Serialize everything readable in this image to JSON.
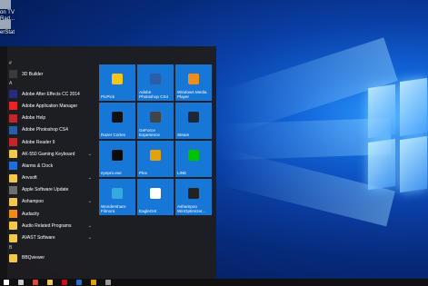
{
  "desktop": {
    "icons": [
      {
        "label": "on TV"
      },
      {
        "label": "Rad..."
      },
      {
        "label": "erStat"
      }
    ]
  },
  "start_menu": {
    "pinned_top": {
      "label": "3D Builder"
    },
    "sections": [
      {
        "letter": "#",
        "items": [
          {
            "label": "3D Builder"
          }
        ]
      },
      {
        "letter": "A",
        "items": [
          {
            "label": "Adobe After Effects CC 2014",
            "icon": "after-effects-icon",
            "color": "#2a2a7a"
          },
          {
            "label": "Adobe Application Manager",
            "icon": "adobe-icon",
            "color": "#e8242a"
          },
          {
            "label": "Adobe Help",
            "icon": "adobe-help-icon",
            "color": "#c0272d"
          },
          {
            "label": "Adobe Photoshop CS4",
            "icon": "photoshop-icon",
            "color": "#2a5fa8"
          },
          {
            "label": "Adobe Reader 9",
            "icon": "acrobat-icon",
            "color": "#c0272d"
          },
          {
            "label": "AK-550 Gaming Keyboard",
            "icon": "folder-icon",
            "expandable": true
          },
          {
            "label": "Alarms & Clock",
            "icon": "alarm-clock-icon",
            "color": "#1f6fd6"
          },
          {
            "label": "Anvsoft",
            "icon": "folder-icon",
            "expandable": true
          },
          {
            "label": "Apple Software Update",
            "icon": "apple-update-icon",
            "color": "#6e6e6e"
          },
          {
            "label": "Ashampoo",
            "icon": "folder-icon",
            "expandable": true
          },
          {
            "label": "Audacity",
            "icon": "audacity-icon",
            "color": "#f08c1c"
          },
          {
            "label": "Audio Related Programs",
            "icon": "folder-icon",
            "expandable": true
          },
          {
            "label": "AVAST Software",
            "icon": "folder-icon",
            "expandable": true
          }
        ]
      },
      {
        "letter": "B",
        "items": [
          {
            "label": "BBQviewer",
            "icon": "folder-icon"
          }
        ]
      }
    ],
    "tiles": [
      {
        "label": "PicPick",
        "icon": "picpick-icon",
        "color": "#f5c518"
      },
      {
        "label": "Adobe Photoshop CS4",
        "icon": "photoshop-icon",
        "color": "#2a5fa8"
      },
      {
        "label": "Windows Media Player",
        "icon": "media-player-icon",
        "color": "#f08c1c"
      },
      {
        "label": "Razer Cortex",
        "icon": "razer-cortex-icon",
        "color": "#111111"
      },
      {
        "label": "GeForce Experience",
        "icon": "geforce-icon",
        "color": "#444444"
      },
      {
        "label": "Steam",
        "icon": "steam-icon",
        "color": "#1b2838"
      },
      {
        "label": "eyepro.exe",
        "icon": "eyepro-icon",
        "color": "#0b0b0b"
      },
      {
        "label": "Plex",
        "icon": "plex-icon",
        "color": "#e5a00d"
      },
      {
        "label": "LINE",
        "icon": "line-icon",
        "color": "#00c300"
      },
      {
        "label": "Wondershare Filmora",
        "icon": "filmora-icon",
        "color": "#36a9e1"
      },
      {
        "label": "EagleGet",
        "icon": "eagleget-icon",
        "color": "#ffffff"
      },
      {
        "label": "Ashampoo WinOptimizer...",
        "icon": "winoptimizer-icon",
        "color": "#222222"
      }
    ]
  },
  "taskbar": {
    "icons": [
      {
        "name": "start-icon",
        "color": "#ffffff"
      },
      {
        "name": "search-icon",
        "color": "#cccccc"
      },
      {
        "name": "chrome-icon",
        "color": "#dd4b39"
      },
      {
        "name": "file-explorer-icon",
        "color": "#f2c94c"
      },
      {
        "name": "opera-icon",
        "color": "#cc0f16"
      },
      {
        "name": "app-icon-1",
        "color": "#1f6fd6"
      },
      {
        "name": "app-icon-2",
        "color": "#e5a00d"
      },
      {
        "name": "app-icon-3",
        "color": "#999999"
      }
    ]
  }
}
